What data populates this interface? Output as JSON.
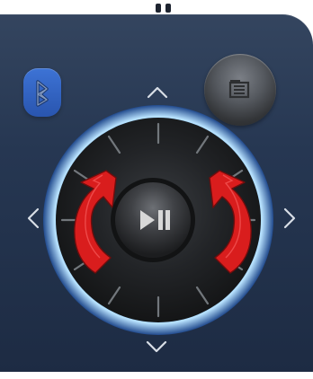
{
  "controller": {
    "bluetooth_icon": "bluetooth-icon",
    "menu_icon": "menu-icon",
    "up_icon": "chevron-up-icon",
    "down_icon": "chevron-down-icon",
    "left_icon": "chevron-left-icon",
    "right_icon": "chevron-right-icon",
    "play_pause_icon": "play-pause-icon",
    "rotate_ccw_icon": "rotate-counterclockwise-icon",
    "rotate_cw_icon": "rotate-clockwise-icon"
  },
  "colors": {
    "device": "#263752",
    "bluetooth": "#2f63c6",
    "menu_button": "#55595f",
    "wheel_ring": "#68b8ff",
    "wheel_face": "#202224",
    "rotation_arrow": "#d51d1d"
  }
}
